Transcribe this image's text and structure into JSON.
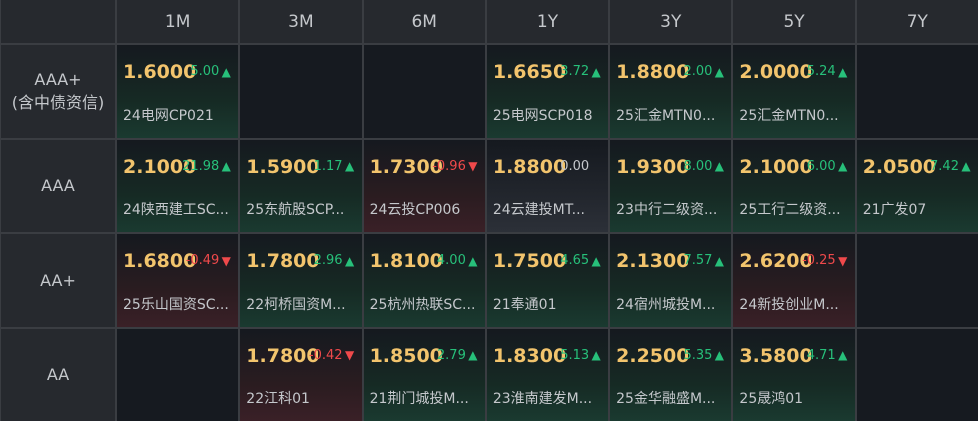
{
  "columns": [
    "1M",
    "3M",
    "6M",
    "1Y",
    "3Y",
    "5Y",
    "7Y"
  ],
  "rows": [
    {
      "label_lines": [
        "AAA+",
        "(含中债资信)"
      ],
      "cells": [
        {
          "price": "1.6000",
          "change": "5.00",
          "dir": "up",
          "name": "24电网CP021"
        },
        null,
        null,
        {
          "price": "1.6650",
          "change": "3.72",
          "dir": "up",
          "name": "25电网SCP018"
        },
        {
          "price": "1.8800",
          "change": "2.00",
          "dir": "up",
          "name": "25汇金MTN0..."
        },
        {
          "price": "2.0000",
          "change": "5.24",
          "dir": "up",
          "name": "25汇金MTN0..."
        },
        null
      ]
    },
    {
      "label_lines": [
        "AAA"
      ],
      "cells": [
        {
          "price": "2.1000",
          "change": "21.98",
          "dir": "up",
          "name": "24陕西建工SC..."
        },
        {
          "price": "1.5900",
          "change": "1.17",
          "dir": "up",
          "name": "25东航股SCP..."
        },
        {
          "price": "1.7300",
          "change": "-0.96",
          "dir": "down",
          "name": "24云投CP006"
        },
        {
          "price": "1.8800",
          "change": "0.00",
          "dir": "flat",
          "name": "24云建投MT..."
        },
        {
          "price": "1.9300",
          "change": "8.00",
          "dir": "up",
          "name": "23中行二级资..."
        },
        {
          "price": "2.1000",
          "change": "6.00",
          "dir": "up",
          "name": "25工行二级资..."
        },
        {
          "price": "2.0500",
          "change": "7.42",
          "dir": "up",
          "name": "21广发07"
        }
      ]
    },
    {
      "label_lines": [
        "AA+"
      ],
      "cells": [
        {
          "price": "1.6800",
          "change": "-0.49",
          "dir": "down",
          "name": "25乐山国资SC..."
        },
        {
          "price": "1.7800",
          "change": "2.96",
          "dir": "up",
          "name": "22柯桥国资M..."
        },
        {
          "price": "1.8100",
          "change": "4.00",
          "dir": "up",
          "name": "25杭州热联SC..."
        },
        {
          "price": "1.7500",
          "change": "4.65",
          "dir": "up",
          "name": "21奉通01"
        },
        {
          "price": "2.1300",
          "change": "7.57",
          "dir": "up",
          "name": "24宿州城投M..."
        },
        {
          "price": "2.6200",
          "change": "-0.25",
          "dir": "down",
          "name": "24新投创业M..."
        },
        null
      ]
    },
    {
      "label_lines": [
        "AA"
      ],
      "cells": [
        null,
        {
          "price": "1.7800",
          "change": "-0.42",
          "dir": "down",
          "name": "22江科01"
        },
        {
          "price": "1.8500",
          "change": "2.79",
          "dir": "up",
          "name": "21荆门城投M..."
        },
        {
          "price": "1.8300",
          "change": "5.13",
          "dir": "up",
          "name": "23淮南建发M..."
        },
        {
          "price": "2.2500",
          "change": "5.35",
          "dir": "up",
          "name": "25金华融盛M..."
        },
        {
          "price": "3.5800",
          "change": "4.71",
          "dir": "up",
          "name": "25晟鸿01"
        },
        null
      ]
    }
  ],
  "colors": {
    "up": "#27c07a",
    "down": "#f0494b",
    "price": "#f2c46d"
  },
  "icons": {
    "up": "triangle-up-icon",
    "down": "triangle-down-icon"
  }
}
